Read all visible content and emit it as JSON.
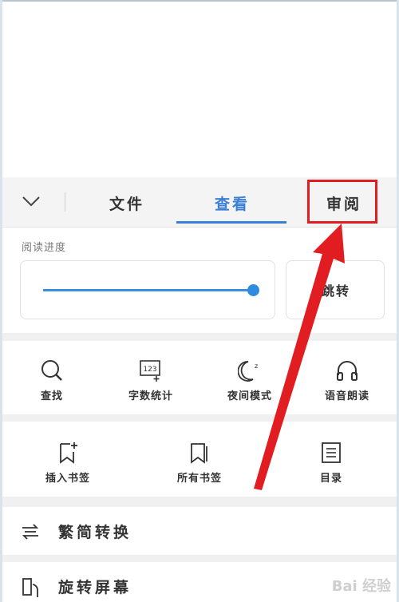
{
  "tabs": {
    "file": "文件",
    "view": "查看",
    "review": "审阅"
  },
  "progress": {
    "title": "阅读进度",
    "value": 1.0,
    "jump_label": "跳转"
  },
  "tools": [
    {
      "label": "查找",
      "icon": "search-icon"
    },
    {
      "label": "字数统计",
      "icon": "word-count-icon"
    },
    {
      "label": "夜间模式",
      "icon": "night-mode-icon"
    },
    {
      "label": "语音朗读",
      "icon": "headphones-icon"
    }
  ],
  "bookmarks": [
    {
      "label": "插入书签",
      "icon": "insert-bookmark-icon"
    },
    {
      "label": "所有书签",
      "icon": "bookmarks-icon"
    },
    {
      "label": "目录",
      "icon": "toc-icon"
    }
  ],
  "rows": {
    "convert": "繁简转换",
    "rotate": "旋转屏幕"
  },
  "icon_text": {
    "word_count": "123"
  },
  "watermark": "Bai 经验",
  "colors": {
    "accent": "#3a7fd6",
    "highlight": "#e21d22"
  }
}
